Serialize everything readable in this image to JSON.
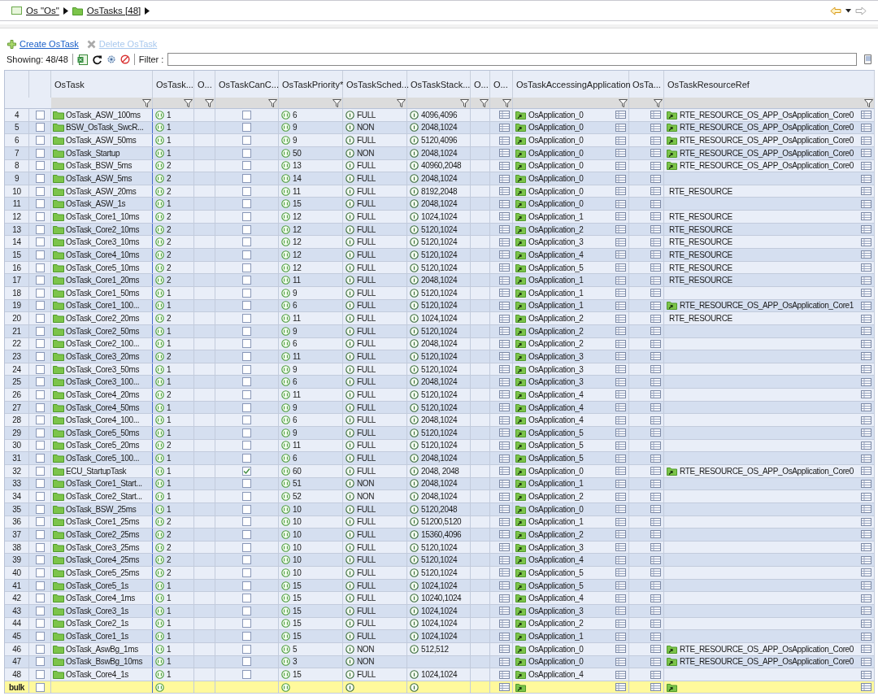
{
  "breadcrumb": [
    {
      "label": "Os \"Os\"",
      "kind": "module"
    },
    {
      "label": "OsTasks [48]",
      "kind": "folder"
    }
  ],
  "actions": [
    {
      "label": "Create OsTask",
      "kind": "create",
      "disabled": false
    },
    {
      "label": "Delete OsTask",
      "kind": "delete",
      "disabled": true
    }
  ],
  "showing": "Showing: 48/48",
  "filter": {
    "label": "Filter :"
  },
  "columns": [
    {
      "label": "OsTask"
    },
    {
      "label": "OsTask..."
    },
    {
      "label": "O..."
    },
    {
      "label": "OsTaskCanC..."
    },
    {
      "label": "OsTaskPriority*"
    },
    {
      "label": "OsTaskSched..."
    },
    {
      "label": "OsTaskStack..."
    },
    {
      "label": "O..."
    },
    {
      "label": "O..."
    },
    {
      "label": "OsTaskAccessingApplication"
    },
    {
      "label": "OsTa..."
    },
    {
      "label": "OsTaskResourceRef"
    }
  ],
  "rows": [
    {
      "n": "4",
      "checked": false,
      "name": "OsTask_ASW_100ms",
      "activation": "1",
      "cancel": false,
      "priority": "6",
      "schedule": "FULL",
      "stack": "4096,4096",
      "application": "OsApplication_0",
      "resource": {
        "kind": "ref",
        "label": "RTE_RESOURCE_OS_APP_OsApplication_Core0"
      }
    },
    {
      "n": "5",
      "checked": false,
      "name": "BSW_OsTask_SwcR...",
      "activation": "1",
      "cancel": false,
      "priority": "9",
      "schedule": "NON",
      "stack": "2048,1024",
      "application": "OsApplication_0",
      "resource": {
        "kind": "ref",
        "label": "RTE_RESOURCE_OS_APP_OsApplication_Core0"
      }
    },
    {
      "n": "6",
      "checked": false,
      "name": "OsTask_ASW_50ms",
      "activation": "1",
      "cancel": false,
      "priority": "9",
      "schedule": "FULL",
      "stack": "5120,4096",
      "application": "OsApplication_0",
      "resource": {
        "kind": "ref",
        "label": "RTE_RESOURCE_OS_APP_OsApplication_Core0"
      }
    },
    {
      "n": "7",
      "checked": false,
      "name": "OsTask_Startup",
      "activation": "1",
      "cancel": false,
      "priority": "50",
      "schedule": "NON",
      "stack": "2048,1024",
      "application": "OsApplication_0",
      "resource": {
        "kind": "ref",
        "label": "RTE_RESOURCE_OS_APP_OsApplication_Core0"
      }
    },
    {
      "n": "8",
      "checked": false,
      "name": "OsTask_BSW_5ms",
      "activation": "2",
      "cancel": false,
      "priority": "13",
      "schedule": "FULL",
      "stack": "40960,2048",
      "application": "OsApplication_0",
      "resource": {
        "kind": "ref",
        "label": "RTE_RESOURCE_OS_APP_OsApplication_Core0"
      }
    },
    {
      "n": "9",
      "checked": false,
      "name": "OsTask_ASW_5ms",
      "activation": "2",
      "cancel": false,
      "priority": "14",
      "schedule": "FULL",
      "stack": "2048,1024",
      "application": "OsApplication_0"
    },
    {
      "n": "10",
      "checked": false,
      "name": "OsTask_ASW_20ms",
      "activation": "2",
      "cancel": false,
      "priority": "11",
      "schedule": "FULL",
      "stack": "8192,2048",
      "application": "OsApplication_0",
      "resource": {
        "kind": "text",
        "label": "RTE_RESOURCE"
      }
    },
    {
      "n": "11",
      "checked": false,
      "name": "OsTask_ASW_1s",
      "activation": "1",
      "cancel": false,
      "priority": "15",
      "schedule": "FULL",
      "stack": "2048,1024",
      "application": "OsApplication_0"
    },
    {
      "n": "12",
      "checked": false,
      "name": "OsTask_Core1_10ms",
      "activation": "2",
      "cancel": false,
      "priority": "12",
      "schedule": "FULL",
      "stack": "1024,1024",
      "application": "OsApplication_1",
      "resource": {
        "kind": "text",
        "label": "RTE_RESOURCE"
      }
    },
    {
      "n": "13",
      "checked": false,
      "name": "OsTask_Core2_10ms",
      "activation": "2",
      "cancel": false,
      "priority": "12",
      "schedule": "FULL",
      "stack": "5120,1024",
      "application": "OsApplication_2",
      "resource": {
        "kind": "text",
        "label": "RTE_RESOURCE"
      }
    },
    {
      "n": "14",
      "checked": false,
      "name": "OsTask_Core3_10ms",
      "activation": "2",
      "cancel": false,
      "priority": "12",
      "schedule": "FULL",
      "stack": "5120,1024",
      "application": "OsApplication_3",
      "resource": {
        "kind": "text",
        "label": "RTE_RESOURCE"
      }
    },
    {
      "n": "15",
      "checked": false,
      "name": "OsTask_Core4_10ms",
      "activation": "2",
      "cancel": false,
      "priority": "12",
      "schedule": "FULL",
      "stack": "5120,1024",
      "application": "OsApplication_4",
      "resource": {
        "kind": "text",
        "label": "RTE_RESOURCE"
      }
    },
    {
      "n": "16",
      "checked": false,
      "name": "OsTask_Core5_10ms",
      "activation": "2",
      "cancel": false,
      "priority": "12",
      "schedule": "FULL",
      "stack": "5120,1024",
      "application": "OsApplication_5",
      "resource": {
        "kind": "text",
        "label": "RTE_RESOURCE"
      }
    },
    {
      "n": "17",
      "checked": false,
      "name": "OsTask_Core1_20ms",
      "activation": "2",
      "cancel": false,
      "priority": "11",
      "schedule": "FULL",
      "stack": "2048,1024",
      "application": "OsApplication_1",
      "resource": {
        "kind": "text",
        "label": "RTE_RESOURCE"
      }
    },
    {
      "n": "18",
      "checked": false,
      "name": "OsTask_Core1_50ms",
      "activation": "1",
      "cancel": false,
      "priority": "9",
      "schedule": "FULL",
      "stack": "5120,1024",
      "application": "OsApplication_1"
    },
    {
      "n": "19",
      "checked": false,
      "name": "OsTask_Core1_100...",
      "activation": "1",
      "cancel": false,
      "priority": "6",
      "schedule": "FULL",
      "stack": "5120,1024",
      "application": "OsApplication_1",
      "resource": {
        "kind": "ref",
        "label": "RTE_RESOURCE_OS_APP_OsApplication_Core1"
      }
    },
    {
      "n": "20",
      "checked": false,
      "name": "OsTask_Core2_20ms",
      "activation": "2",
      "cancel": false,
      "priority": "11",
      "schedule": "FULL",
      "stack": "1024,1024",
      "application": "OsApplication_2",
      "resource": {
        "kind": "text",
        "label": "RTE_RESOURCE"
      }
    },
    {
      "n": "21",
      "checked": false,
      "name": "OsTask_Core2_50ms",
      "activation": "1",
      "cancel": false,
      "priority": "9",
      "schedule": "FULL",
      "stack": "5120,1024",
      "application": "OsApplication_2"
    },
    {
      "n": "22",
      "checked": false,
      "name": "OsTask_Core2_100...",
      "activation": "1",
      "cancel": false,
      "priority": "6",
      "schedule": "FULL",
      "stack": "2048,1024",
      "application": "OsApplication_2"
    },
    {
      "n": "23",
      "checked": false,
      "name": "OsTask_Core3_20ms",
      "activation": "2",
      "cancel": false,
      "priority": "11",
      "schedule": "FULL",
      "stack": "5120,1024",
      "application": "OsApplication_3"
    },
    {
      "n": "24",
      "checked": false,
      "name": "OsTask_Core3_50ms",
      "activation": "1",
      "cancel": false,
      "priority": "9",
      "schedule": "FULL",
      "stack": "5120,1024",
      "application": "OsApplication_3"
    },
    {
      "n": "25",
      "checked": false,
      "name": "OsTask_Core3_100...",
      "activation": "1",
      "cancel": false,
      "priority": "6",
      "schedule": "FULL",
      "stack": "2048,1024",
      "application": "OsApplication_3"
    },
    {
      "n": "26",
      "checked": false,
      "name": "OsTask_Core4_20ms",
      "activation": "2",
      "cancel": false,
      "priority": "11",
      "schedule": "FULL",
      "stack": "5120,1024",
      "application": "OsApplication_4"
    },
    {
      "n": "27",
      "checked": false,
      "name": "OsTask_Core4_50ms",
      "activation": "1",
      "cancel": false,
      "priority": "9",
      "schedule": "FULL",
      "stack": "5120,1024",
      "application": "OsApplication_4"
    },
    {
      "n": "28",
      "checked": false,
      "name": "OsTask_Core4_100...",
      "activation": "1",
      "cancel": false,
      "priority": "6",
      "schedule": "FULL",
      "stack": "2048,1024",
      "application": "OsApplication_4"
    },
    {
      "n": "29",
      "checked": false,
      "name": "OsTask_Core5_50ms",
      "activation": "1",
      "cancel": false,
      "priority": "9",
      "schedule": "FULL",
      "stack": "5120,1024",
      "application": "OsApplication_5"
    },
    {
      "n": "30",
      "checked": false,
      "name": "OsTask_Core5_20ms",
      "activation": "2",
      "cancel": false,
      "priority": "11",
      "schedule": "FULL",
      "stack": "5120,1024",
      "application": "OsApplication_5"
    },
    {
      "n": "31",
      "checked": false,
      "name": "OsTask_Core5_100...",
      "activation": "1",
      "cancel": false,
      "priority": "6",
      "schedule": "FULL",
      "stack": "2048,1024",
      "application": "OsApplication_5"
    },
    {
      "n": "32",
      "checked": false,
      "name": "ECU_StartupTask",
      "activation": "1",
      "cancel": true,
      "priority": "60",
      "schedule": "FULL",
      "stack": "2048, 2048",
      "application": "OsApplication_0",
      "resource": {
        "kind": "ref",
        "label": "RTE_RESOURCE_OS_APP_OsApplication_Core0"
      }
    },
    {
      "n": "33",
      "checked": false,
      "name": "OsTask_Core1_Start...",
      "activation": "1",
      "cancel": false,
      "priority": "51",
      "schedule": "NON",
      "stack": "2048,1024",
      "application": "OsApplication_1"
    },
    {
      "n": "34",
      "checked": false,
      "name": "OsTask_Core2_Start...",
      "activation": "1",
      "cancel": false,
      "priority": "52",
      "schedule": "NON",
      "stack": "2048,1024",
      "application": "OsApplication_2"
    },
    {
      "n": "35",
      "checked": false,
      "name": "OsTask_BSW_25ms",
      "activation": "1",
      "cancel": false,
      "priority": "10",
      "schedule": "FULL",
      "stack": "5120,2048",
      "application": "OsApplication_0"
    },
    {
      "n": "36",
      "checked": false,
      "name": "OsTask_Core1_25ms",
      "activation": "2",
      "cancel": false,
      "priority": "10",
      "schedule": "FULL",
      "stack": "51200,5120",
      "application": "OsApplication_1"
    },
    {
      "n": "37",
      "checked": false,
      "name": "OsTask_Core2_25ms",
      "activation": "2",
      "cancel": false,
      "priority": "10",
      "schedule": "FULL",
      "stack": "15360,4096",
      "application": "OsApplication_2"
    },
    {
      "n": "38",
      "checked": false,
      "name": "OsTask_Core3_25ms",
      "activation": "2",
      "cancel": false,
      "priority": "10",
      "schedule": "FULL",
      "stack": "5120,1024",
      "application": "OsApplication_3"
    },
    {
      "n": "39",
      "checked": false,
      "name": "OsTask_Core4_25ms",
      "activation": "2",
      "cancel": false,
      "priority": "10",
      "schedule": "FULL",
      "stack": "5120,1024",
      "application": "OsApplication_4"
    },
    {
      "n": "40",
      "checked": false,
      "name": "OsTask_Core5_25ms",
      "activation": "2",
      "cancel": false,
      "priority": "10",
      "schedule": "FULL",
      "stack": "5120,1024",
      "application": "OsApplication_5"
    },
    {
      "n": "41",
      "checked": false,
      "name": "OsTask_Core5_1s",
      "activation": "1",
      "cancel": false,
      "priority": "15",
      "schedule": "FULL",
      "stack": "1024,1024",
      "application": "OsApplication_5"
    },
    {
      "n": "42",
      "checked": false,
      "name": "OsTask_Core4_1ms",
      "activation": "1",
      "cancel": false,
      "priority": "15",
      "schedule": "FULL",
      "stack": "10240,1024",
      "application": "OsApplication_4"
    },
    {
      "n": "43",
      "checked": false,
      "name": "OsTask_Core3_1s",
      "activation": "1",
      "cancel": false,
      "priority": "15",
      "schedule": "FULL",
      "stack": "1024,1024",
      "application": "OsApplication_3"
    },
    {
      "n": "44",
      "checked": false,
      "name": "OsTask_Core2_1s",
      "activation": "1",
      "cancel": false,
      "priority": "15",
      "schedule": "FULL",
      "stack": "1024,1024",
      "application": "OsApplication_2"
    },
    {
      "n": "45",
      "checked": false,
      "name": "OsTask_Core1_1s",
      "activation": "1",
      "cancel": false,
      "priority": "15",
      "schedule": "FULL",
      "stack": "1024,1024",
      "application": "OsApplication_1"
    },
    {
      "n": "46",
      "checked": false,
      "name": "OsTask_AswBg_1ms",
      "activation": "1",
      "cancel": false,
      "priority": "5",
      "schedule": "NON",
      "stack": "512,512",
      "application": "OsApplication_0",
      "resource": {
        "kind": "ref",
        "label": "RTE_RESOURCE_OS_APP_OsApplication_Core0"
      }
    },
    {
      "n": "47",
      "checked": false,
      "name": "OsTask_BswBg_10ms",
      "activation": "1",
      "cancel": false,
      "priority": "3",
      "schedule": "NON",
      "application": "OsApplication_0",
      "resource": {
        "kind": "ref",
        "label": "RTE_RESOURCE_OS_APP_OsApplication_Core0"
      }
    },
    {
      "n": "48",
      "checked": false,
      "name": "OsTask_Core4_1s",
      "activation": "1",
      "cancel": false,
      "priority": "15",
      "schedule": "FULL",
      "stack": "1024,1024",
      "application": "OsApplication_4"
    }
  ],
  "bulk": {
    "label": "bulk",
    "checked": false
  }
}
